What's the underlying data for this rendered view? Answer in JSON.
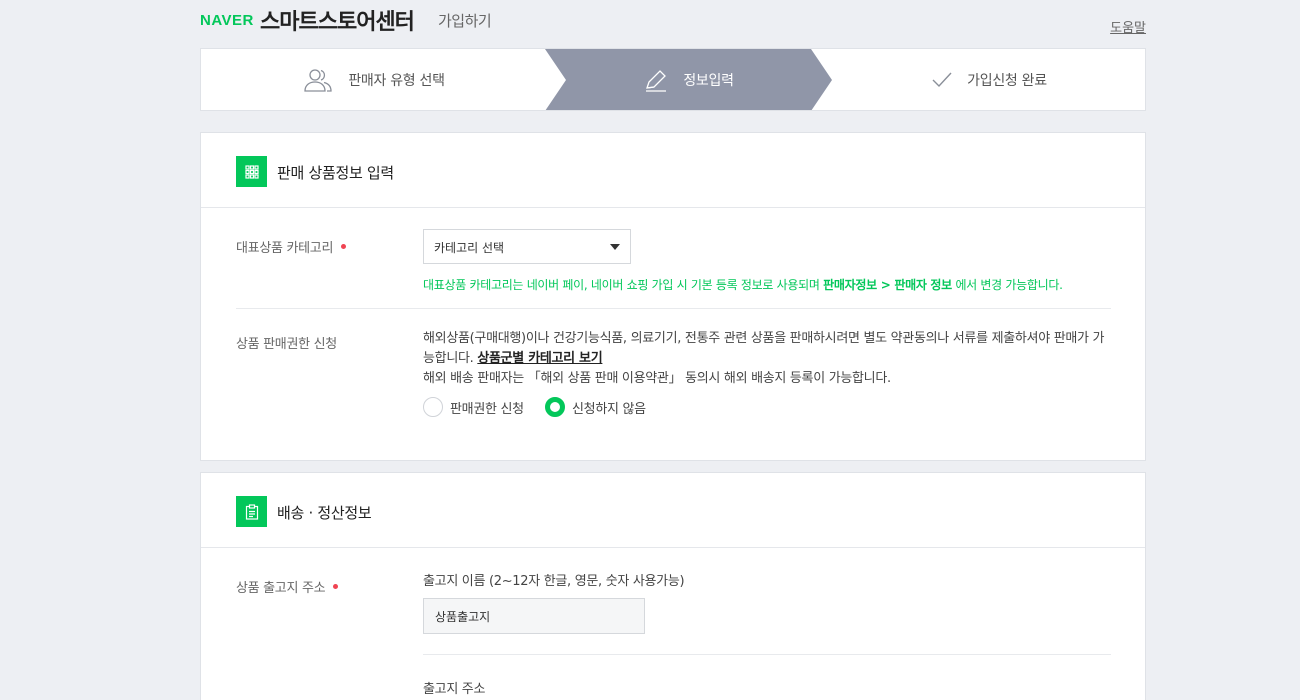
{
  "header": {
    "brand": "NAVER",
    "product": "스마트스토어센터",
    "join": "가입하기",
    "help": "도움말"
  },
  "steps": [
    {
      "label": "판매자 유형 선택",
      "icon": "users-icon",
      "active": false
    },
    {
      "label": "정보입력",
      "icon": "pencil-icon",
      "active": true
    },
    {
      "label": "가입신청 완료",
      "icon": "check-icon",
      "active": false
    }
  ],
  "colors": {
    "brand": "#03c75a",
    "active_step": "#9096a8",
    "required": "#f04452"
  },
  "section_product": {
    "title": "판매 상품정보 입력",
    "icon": "grid-icon",
    "category": {
      "label": "대표상품 카테고리",
      "select_value": "카테고리 선택",
      "note_prefix": "대표상품 카테고리는 네이버 페이, 네이버 쇼핑 가입 시 기본 등록 정보로 사용되며",
      "note_bold": "판매자정보 > 판매자 정보",
      "note_suffix": "에서 변경 가능합니다."
    },
    "permission": {
      "label": "상품 판매권한 신청",
      "text_line1": "해외상품(구매대행)이나 건강기능식품, 의료기기, 전통주 관련 상품을 판매하시려면 별도 약관동의나 서류를 제출하셔야 판매가 가능합니다.",
      "link": "상품군별 카테고리 보기",
      "text_line2": "해외 배송 판매자는 「해외 상품 판매 이용약관」 동의시 해외 배송지 등록이 가능합니다.",
      "options": [
        {
          "label": "판매권한 신청",
          "selected": false
        },
        {
          "label": "신청하지 않음",
          "selected": true
        }
      ]
    }
  },
  "section_shipping": {
    "title": "배송 · 정산정보",
    "icon": "clipboard-icon",
    "address": {
      "label": "상품 출고지 주소",
      "name_label": "출고지 이름 (2~12자 한글, 영문, 숫자 사용가능)",
      "name_value": "상품출고지",
      "address_label": "출고지 주소"
    }
  }
}
